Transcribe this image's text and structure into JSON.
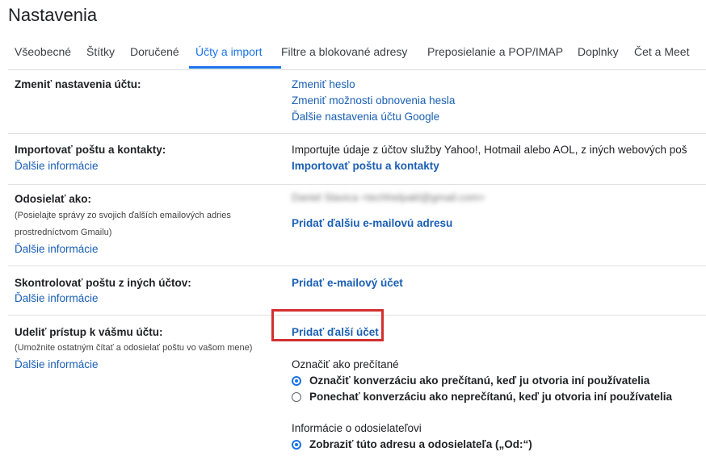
{
  "page_title": "Nastavenia",
  "tabs": [
    {
      "label": "Všeobecné"
    },
    {
      "label": "Štítky"
    },
    {
      "label": "Doručené"
    },
    {
      "label": "Účty a import"
    },
    {
      "label": "Filtre a blokované adresy"
    },
    {
      "label": "Preposielanie a POP/IMAP"
    },
    {
      "label": "Doplnky"
    },
    {
      "label": "Čet a Meet"
    }
  ],
  "active_tab": "Účty a import",
  "rows": {
    "change_account": {
      "label": "Zmeniť nastavenia účtu:",
      "links": [
        "Zmeniť heslo",
        "Zmeniť možnosti obnovenia hesla",
        "Ďalšie nastavenia účtu Google"
      ]
    },
    "import": {
      "label": "Importovať poštu a kontakty:",
      "more": "Ďalšie informácie",
      "description": "Importujte údaje z účtov služby Yahoo!, Hotmail alebo AOL, z iných webových poš",
      "action": "Importovať poštu a kontakty"
    },
    "send_as": {
      "label": "Odosielať ako:",
      "note1": "(Posielajte správy zo svojich ďalších emailových adries",
      "note2": "prostredníctvom Gmailu)",
      "more": "Ďalšie informácie",
      "address": "Daniel Slavica <techhelpakl@gmail.com>",
      "action": "Pridať ďalšiu e-mailovú adresu"
    },
    "check_mail": {
      "label": "Skontrolovať poštu z iných účtov:",
      "more": "Ďalšie informácie",
      "action": "Pridať e-mailový účet"
    },
    "grant_access": {
      "label": "Udeliť prístup k vášmu účtu:",
      "note": "(Umožnite ostatným čítať a odosielať poštu vo vašom mene)",
      "more": "Ďalšie informácie",
      "action": "Pridať ďalší účet",
      "mark_read": {
        "heading": "Označiť ako prečítané",
        "options": [
          {
            "label": "Označiť konverzáciu ako prečítanú, keď ju otvoria iní používatelia",
            "selected": true
          },
          {
            "label": "Ponechať konverzáciu ako neprečítanú, keď ju otvoria iní používatelia",
            "selected": false
          }
        ]
      },
      "sender_info": {
        "heading": "Informácie o odosielateľovi",
        "options": [
          {
            "label": "Zobraziť túto adresu a odosielateľa („Od:“)",
            "selected": true
          }
        ]
      }
    }
  },
  "colors": {
    "accent": "#1a73e8",
    "link": "#1a5fb4",
    "highlight": "#d32f2f"
  }
}
